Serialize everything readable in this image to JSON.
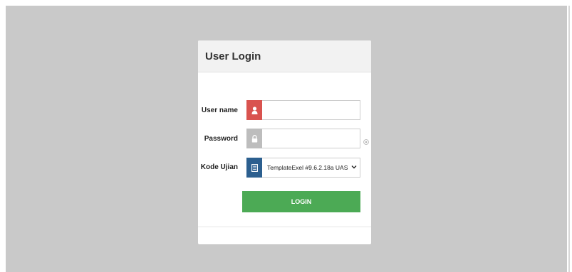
{
  "login_panel": {
    "title": "User Login",
    "username": {
      "label": "User name",
      "value": "",
      "icon": "user-icon"
    },
    "password": {
      "label": "Password",
      "value": "",
      "icon": "lock-icon",
      "toggle_icon": "eye-icon"
    },
    "exam_code": {
      "label": "Kode Ujian",
      "selected": "TemplateExel #9.6.2.18a UAS",
      "icon": "document-icon"
    },
    "login_button": "LOGIN"
  },
  "colors": {
    "background": "#c9c9c9",
    "user_addon": "#d9534f",
    "lock_addon": "#bdbdbd",
    "exam_addon": "#2c5f8f",
    "login_button": "#4caa55"
  }
}
